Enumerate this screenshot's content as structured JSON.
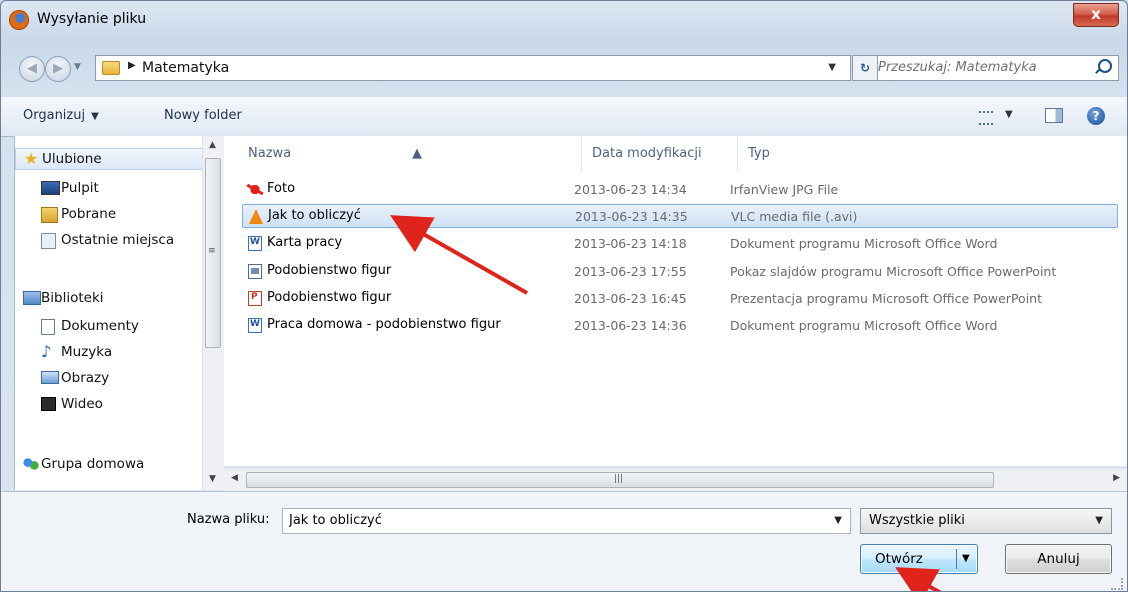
{
  "window": {
    "title": "Wysyłanie pliku",
    "close_glyph": "x"
  },
  "address": {
    "breadcrumb": "Matematyka"
  },
  "search": {
    "placeholder": "Przeszukaj: Matematyka"
  },
  "toolbar": {
    "organize_label": "Organizuj",
    "new_folder_label": "Nowy folder"
  },
  "sidebar": {
    "items": [
      {
        "label": "Ulubione",
        "icon": "star-icon",
        "level": 0,
        "selected": true
      },
      {
        "label": "Pulpit",
        "icon": "desktop-icon",
        "level": 1
      },
      {
        "label": "Pobrane",
        "icon": "downloads-icon",
        "level": 1
      },
      {
        "label": "Ostatnie miejsca",
        "icon": "recent-places-icon",
        "level": 1
      },
      {
        "label": "Biblioteki",
        "icon": "libraries-icon",
        "level": 0
      },
      {
        "label": "Dokumenty",
        "icon": "documents-icon",
        "level": 1
      },
      {
        "label": "Muzyka",
        "icon": "music-icon",
        "level": 1
      },
      {
        "label": "Obrazy",
        "icon": "pictures-icon",
        "level": 1
      },
      {
        "label": "Wideo",
        "icon": "video-icon",
        "level": 1
      },
      {
        "label": "Grupa domowa",
        "icon": "homegroup-icon",
        "level": 0
      }
    ]
  },
  "files": {
    "columns": {
      "name": "Nazwa",
      "date": "Data modyfikacji",
      "type": "Typ"
    },
    "rows": [
      {
        "name": "Foto",
        "date": "2013-06-23 14:34",
        "type": "IrfanView JPG File",
        "icon": "irfanview-icon"
      },
      {
        "name": "Jak to obliczyć",
        "date": "2013-06-23 14:35",
        "type": "VLC media file (.avi)",
        "icon": "vlc-icon",
        "selected": true
      },
      {
        "name": "Karta pracy",
        "date": "2013-06-23 14:18",
        "type": "Dokument programu Microsoft Office Word",
        "icon": "word-doc-icon"
      },
      {
        "name": "Podobienstwo figur",
        "date": "2013-06-23 17:55",
        "type": "Pokaz slajdów programu Microsoft Office PowerPoint",
        "icon": "powerpoint-show-icon"
      },
      {
        "name": "Podobienstwo figur",
        "date": "2013-06-23 16:45",
        "type": "Prezentacja programu Microsoft Office PowerPoint",
        "icon": "powerpoint-icon"
      },
      {
        "name": "Praca domowa - podobienstwo figur",
        "date": "2013-06-23 14:36",
        "type": "Dokument programu Microsoft Office Word",
        "icon": "word-doc-icon"
      }
    ]
  },
  "footer": {
    "filename_label": "Nazwa pliku:",
    "filename_value": "Jak to obliczyć",
    "filetype_value": "Wszystkie pliki",
    "open_label": "Otwórz",
    "cancel_label": "Anuluj"
  },
  "colors": {
    "annotation_arrow": "#e0241b",
    "selection": "#cfe1f6"
  }
}
